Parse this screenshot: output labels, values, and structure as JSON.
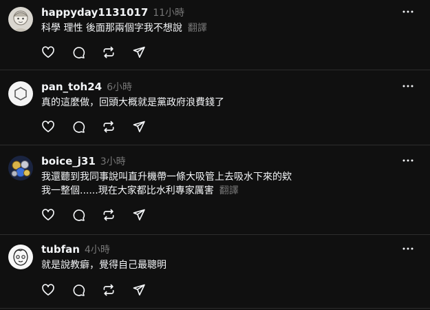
{
  "ui": {
    "more_label": "⋯"
  },
  "posts": [
    {
      "username": "happyday1131017",
      "time": "11小時",
      "lines": [
        "科學 理性 後面那兩個字我不想說"
      ],
      "translate": "翻譯",
      "avatar": "illustrated-face-avatar"
    },
    {
      "username": "pan_toh24",
      "time": "6小時",
      "lines": [
        "真的這麼做，回頭大概就是黨政府浪費錢了"
      ],
      "translate": "",
      "avatar": "default-hexagon-avatar"
    },
    {
      "username": "boice_j31",
      "time": "3小時",
      "lines": [
        "我還聽到我同事說叫直升機帶一條大吸管上去吸水下來的欸",
        "我一整個......現在大家都比水利專家厲害"
      ],
      "translate": "翻譯",
      "avatar": "coins-avatar"
    },
    {
      "username": "tubfan",
      "time": "4小時",
      "lines": [
        "就是說教癖，覺得自己最聰明"
      ],
      "translate": "",
      "avatar": "sketch-face-avatar"
    }
  ],
  "colors": {
    "background": "#101010",
    "text_primary": "#f3f5f7",
    "text_secondary": "#777777",
    "divider": "#2d2d2d"
  }
}
